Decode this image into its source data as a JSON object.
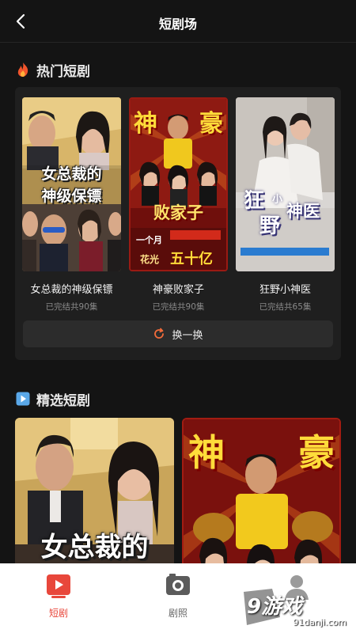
{
  "header": {
    "title": "短剧场",
    "back_icon": "chevron-left-icon"
  },
  "hot_section": {
    "title": "热门短剧",
    "icon": "fire-icon",
    "items": [
      {
        "title": "女总裁的神级保镖",
        "status": "已完结共90集",
        "poster_text": [
          "女总裁的",
          "神级保镖"
        ]
      },
      {
        "title": "神豪败家子",
        "status": "已完结共90集",
        "poster_text": [
          "神",
          "豪",
          "败家子",
          "一个月",
          "花光",
          "五十亿"
        ]
      },
      {
        "title": "狂野小神医",
        "status": "已完结共65集",
        "poster_text": [
          "狂",
          "野",
          "小",
          "神医"
        ]
      }
    ],
    "refresh_label": "换一换",
    "refresh_icon": "refresh-icon"
  },
  "featured_section": {
    "title": "精选短剧",
    "icon": "play-square-icon",
    "items": [
      {
        "poster_text": "女总裁的"
      },
      {
        "poster_text": [
          "神",
          "豪"
        ]
      }
    ]
  },
  "tabbar": {
    "items": [
      {
        "label": "短剧",
        "icon": "play-tv-icon",
        "active": true
      },
      {
        "label": "剧照",
        "icon": "photo-icon",
        "active": false
      },
      {
        "label": "",
        "icon": "user-icon",
        "active": false
      }
    ]
  },
  "watermark": {
    "brand": "9游戏",
    "url": "91danji.com"
  },
  "colors": {
    "background": "#141414",
    "panel": "#1f1f1f",
    "accent": "#e84a3c",
    "refresh": "#f26b3a"
  }
}
